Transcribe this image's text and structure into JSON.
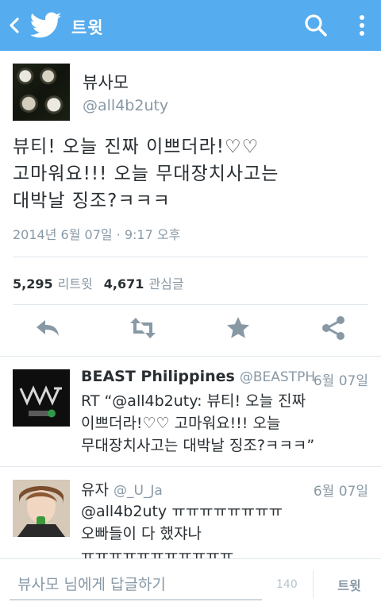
{
  "app_bar": {
    "title": "트윗",
    "back_icon": "chevron-left-icon",
    "logo_icon": "twitter-bird-icon",
    "search_icon": "search-icon",
    "menu_icon": "more-vertical-icon",
    "color": "#55acee"
  },
  "tweet": {
    "author_name": "뷰사모",
    "author_handle": "@all4b2uty",
    "text_lines": [
      "뷰티! 오늘 진짜 이쁘더라!♡♡",
      "고마워요!!! 오늘 무대장치사고는",
      "대박날 징조?ㅋㅋㅋ"
    ],
    "timestamp": "2014년 6월 07일 · 9:17 오후",
    "retweet_count": "5,295",
    "retweet_label": "리트윗",
    "favorite_count": "4,671",
    "favorite_label": "관심글"
  },
  "actions": [
    "reply-icon",
    "retweet-icon",
    "favorite-star-icon",
    "share-icon"
  ],
  "replies": [
    {
      "name": "BEAST Philippines",
      "handle": "@BEASTPH",
      "date": "6월 07일",
      "lines": [
        "RT “@all4b2uty: 뷰티! 오늘 진짜",
        "이쁘더라!♡♡ 고마워요!!! 오늘",
        "무대장치사고는 대박날 징조?ㅋㅋㅋ”"
      ]
    },
    {
      "name": "유자",
      "handle": "@_U_Ja",
      "date": "6월 07일",
      "lines": [
        "@all4b2uty ㅠㅠㅠㅠㅠㅠㅠㅠ",
        "오빠들이 다 했쟈나",
        "ㅠㅠㅠㅠㅠㅠㅠㅠㅠㅠㅠ"
      ]
    }
  ],
  "composer": {
    "placeholder": "뷰사모 님에게 답글하기",
    "char_count": "140",
    "send_label": "트윗"
  }
}
